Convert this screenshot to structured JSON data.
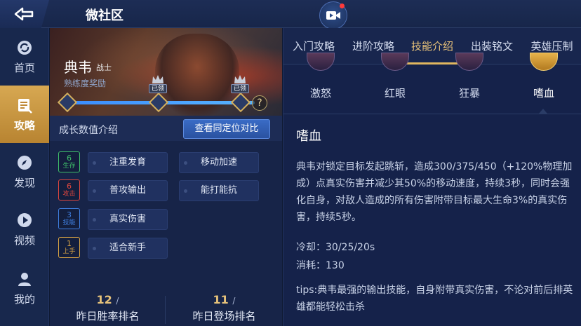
{
  "header": {
    "title": "微社区"
  },
  "nav": {
    "items": [
      {
        "label": "首页",
        "icon": "refresh-icon"
      },
      {
        "label": "攻略",
        "icon": "guide-icon"
      },
      {
        "label": "发现",
        "icon": "compass-icon"
      },
      {
        "label": "视频",
        "icon": "play-icon"
      },
      {
        "label": "我的",
        "icon": "user-icon"
      }
    ],
    "active_index": 1
  },
  "hero": {
    "name": "典韦",
    "role": "战士",
    "proficiency_label": "熟练度奖励",
    "claimed_badge_1": "已领",
    "claimed_badge_2": "已领",
    "help": "?"
  },
  "growth": {
    "title": "成长数值介绍",
    "compare_button": "查看同定位对比",
    "stats": [
      {
        "num": "6",
        "label": "生存",
        "color": "#3fbf6a",
        "tags": [
          "注重发育",
          "移动加速"
        ]
      },
      {
        "num": "6",
        "label": "攻击",
        "color": "#e0473f",
        "tags": [
          "普攻输出",
          "能打能抗"
        ]
      },
      {
        "num": "3",
        "label": "技能",
        "color": "#3f7fe0",
        "tags": [
          "真实伤害"
        ]
      },
      {
        "num": "1",
        "label": "上手",
        "color": "#d9a445",
        "tags": [
          "适合新手"
        ]
      }
    ]
  },
  "ranks": [
    {
      "value": "12",
      "slash": "/",
      "label": "昨日胜率排名"
    },
    {
      "value": "11",
      "slash": "/",
      "label": "昨日登场排名"
    }
  ],
  "tabs": {
    "items": [
      "入门攻略",
      "进阶攻略",
      "技能介绍",
      "出装铭文",
      "英雄压制"
    ],
    "active_index": 2
  },
  "skills": {
    "items": [
      "激怒",
      "红眼",
      "狂暴",
      "嗜血"
    ],
    "active_index": 3
  },
  "skill_detail": {
    "title": "嗜血",
    "description": "典韦对锁定目标发起跳斩，造成300/375/450（+120%物理加成）点真实伤害并减少其50%的移动速度，持续3秒，同时会强化自身，对敌人造成的所有伤害附带目标最大生命3%的真实伤害，持续5秒。",
    "cooldown": "冷却：30/25/20s",
    "cost": "消耗：130",
    "tips": "tips:典韦最强的输出技能，自身附带真实伤害，不论对前后排英雄都能轻松击杀"
  },
  "colors": {
    "accent_gold": "#e0b75f",
    "accent_blue": "#3a6cc6"
  }
}
